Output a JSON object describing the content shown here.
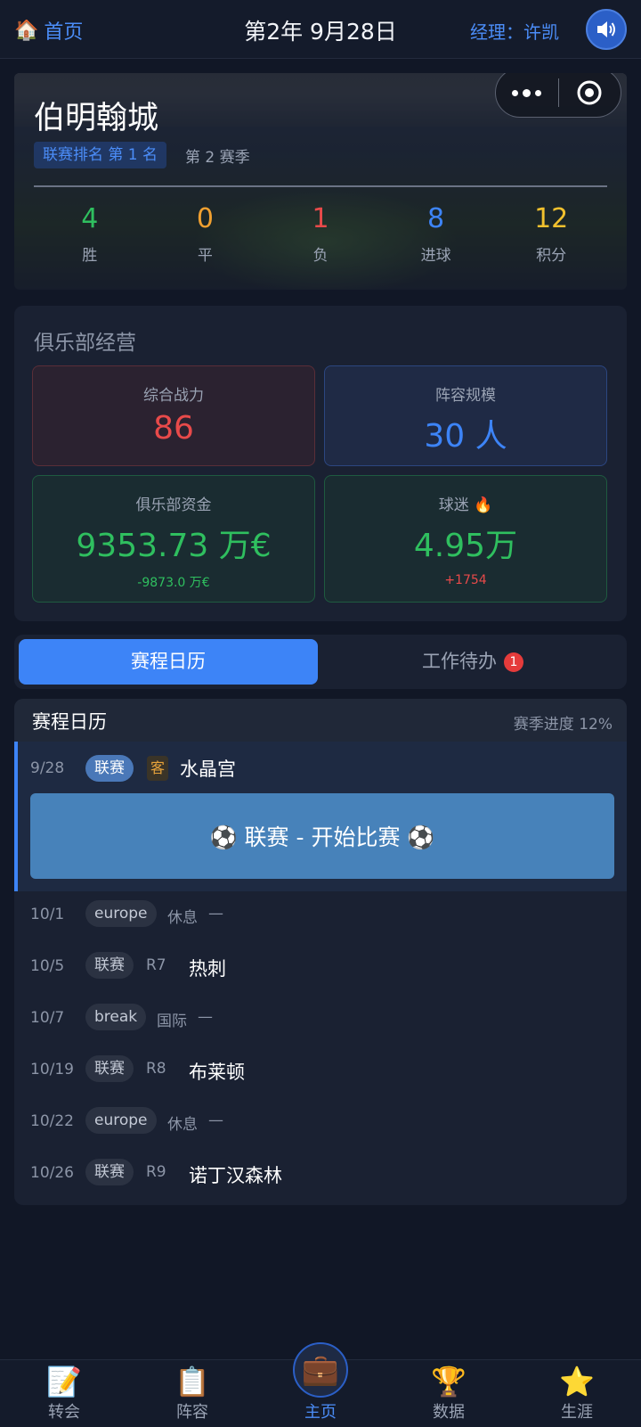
{
  "header": {
    "home_label": "首页",
    "date": "第2年 9月28日",
    "manager": "经理：许凯"
  },
  "club": {
    "name": "伯明翰城",
    "rank": "联赛排名 第 1 名",
    "season": "第 2 赛季",
    "stats": [
      {
        "value": "4",
        "label": "胜",
        "color": "#2fbf5f"
      },
      {
        "value": "0",
        "label": "平",
        "color": "#f0a030"
      },
      {
        "value": "1",
        "label": "负",
        "color": "#e84a4a"
      },
      {
        "value": "8",
        "label": "进球",
        "color": "#3d84f7"
      },
      {
        "value": "12",
        "label": "积分",
        "color": "#f2c12e"
      }
    ]
  },
  "management": {
    "title": "俱乐部经营",
    "power": {
      "label": "综合战力",
      "value": "86",
      "color": "#e84a4a"
    },
    "squad": {
      "label": "阵容规模",
      "value": "30 人",
      "color": "#3d84f7"
    },
    "funds": {
      "label": "俱乐部资金",
      "value": "9353.73 万€",
      "delta": "-9873.0 万€",
      "color": "#2fbf5f"
    },
    "fans": {
      "label": "球迷 🔥",
      "value": "4.95万",
      "delta": "+1754",
      "color": "#2fbf5f",
      "delta_color": "#e84a4a"
    }
  },
  "tabs": {
    "schedule": "赛程日历",
    "todo": "工作待办",
    "todo_count": "1"
  },
  "schedule": {
    "title": "赛程日历",
    "progress": "赛季进度 12%",
    "current": {
      "date": "9/28",
      "competition": "联赛",
      "venue": "客",
      "opponent": "水晶宫",
      "button": "⚽ 联赛 - 开始比赛 ⚽"
    },
    "rows": [
      {
        "date": "10/1",
        "tag": "europe",
        "round": "休息",
        "opponent": "—"
      },
      {
        "date": "10/5",
        "tag": "联赛",
        "round": "R7",
        "opponent": "热刺"
      },
      {
        "date": "10/7",
        "tag": "break",
        "round": "国际",
        "opponent": "—"
      },
      {
        "date": "10/19",
        "tag": "联赛",
        "round": "R8",
        "opponent": "布莱顿"
      },
      {
        "date": "10/22",
        "tag": "europe",
        "round": "休息",
        "opponent": "—"
      },
      {
        "date": "10/26",
        "tag": "联赛",
        "round": "R9",
        "opponent": "诺丁汉森林"
      }
    ]
  },
  "nav": {
    "items": [
      {
        "label": "转会",
        "icon": "📝"
      },
      {
        "label": "阵容",
        "icon": "📋"
      },
      {
        "label": "主页",
        "icon": "💼"
      },
      {
        "label": "数据",
        "icon": "🏆"
      },
      {
        "label": "生涯",
        "icon": "⭐"
      }
    ]
  }
}
